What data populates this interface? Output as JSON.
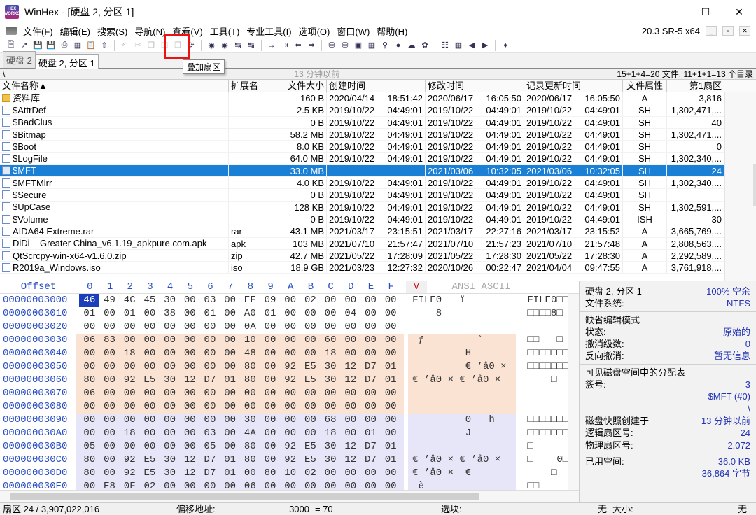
{
  "window": {
    "title": "WinHex - [硬盘 2, 分区 1]",
    "logo_top": "HEX",
    "logo_bottom": "WORKS"
  },
  "menu": {
    "items": [
      "文件(F)",
      "编辑(E)",
      "搜索(S)",
      "导航(N)",
      "查看(V)",
      "工具(T)",
      "专业工具(I)",
      "选项(O)",
      "窗口(W)",
      "帮助(H)"
    ],
    "version": "20.3 SR-5 x64"
  },
  "tooltip": "叠加扇区",
  "tabs": [
    "硬盘 2",
    "硬盘 2, 分区 1"
  ],
  "pathbar": {
    "root": "\\",
    "time": "13 分钟以前",
    "count": "15+1+4=20 文件, 11+1+1=13 个目录"
  },
  "columns": [
    "文件名称▲",
    "扩展名",
    "文件大小",
    "创建时间",
    "修改时间",
    "记录更新时间",
    "文件属性",
    "第1扇区"
  ],
  "files": [
    {
      "name": "资料库",
      "ext": "",
      "size": "160 B",
      "cd": "2020/04/14",
      "ct": "18:51:42",
      "md": "2020/06/17",
      "mt": "16:05:50",
      "rd": "2020/06/17",
      "rt": "16:05:50",
      "attr": "A",
      "sec": "3,816",
      "folder": true
    },
    {
      "name": "$AttrDef",
      "ext": "",
      "size": "2.5 KB",
      "cd": "2019/10/22",
      "ct": "04:49:01",
      "md": "2019/10/22",
      "mt": "04:49:01",
      "rd": "2019/10/22",
      "rt": "04:49:01",
      "attr": "SH",
      "sec": "1,302,471,..."
    },
    {
      "name": "$BadClus",
      "ext": "",
      "size": "0 B",
      "cd": "2019/10/22",
      "ct": "04:49:01",
      "md": "2019/10/22",
      "mt": "04:49:01",
      "rd": "2019/10/22",
      "rt": "04:49:01",
      "attr": "SH",
      "sec": "40"
    },
    {
      "name": "$Bitmap",
      "ext": "",
      "size": "58.2 MB",
      "cd": "2019/10/22",
      "ct": "04:49:01",
      "md": "2019/10/22",
      "mt": "04:49:01",
      "rd": "2019/10/22",
      "rt": "04:49:01",
      "attr": "SH",
      "sec": "1,302,471,..."
    },
    {
      "name": "$Boot",
      "ext": "",
      "size": "8.0 KB",
      "cd": "2019/10/22",
      "ct": "04:49:01",
      "md": "2019/10/22",
      "mt": "04:49:01",
      "rd": "2019/10/22",
      "rt": "04:49:01",
      "attr": "SH",
      "sec": "0"
    },
    {
      "name": "$LogFile",
      "ext": "",
      "size": "64.0 MB",
      "cd": "2019/10/22",
      "ct": "04:49:01",
      "md": "2019/10/22",
      "mt": "04:49:01",
      "rd": "2019/10/22",
      "rt": "04:49:01",
      "attr": "SH",
      "sec": "1,302,340,..."
    },
    {
      "name": "$MFT",
      "ext": "",
      "size": "33.0 MB",
      "cd": "",
      "ct": "",
      "md": "2021/03/06",
      "mt": "10:32:05",
      "rd": "2021/03/06",
      "rt": "10:32:05",
      "attr": "SH",
      "sec": "24",
      "selected": true
    },
    {
      "name": "$MFTMirr",
      "ext": "",
      "size": "4.0 KB",
      "cd": "2019/10/22",
      "ct": "04:49:01",
      "md": "2019/10/22",
      "mt": "04:49:01",
      "rd": "2019/10/22",
      "rt": "04:49:01",
      "attr": "SH",
      "sec": "1,302,340,..."
    },
    {
      "name": "$Secure",
      "ext": "",
      "size": "0 B",
      "cd": "2019/10/22",
      "ct": "04:49:01",
      "md": "2019/10/22",
      "mt": "04:49:01",
      "rd": "2019/10/22",
      "rt": "04:49:01",
      "attr": "SH",
      "sec": ""
    },
    {
      "name": "$UpCase",
      "ext": "",
      "size": "128 KB",
      "cd": "2019/10/22",
      "ct": "04:49:01",
      "md": "2019/10/22",
      "mt": "04:49:01",
      "rd": "2019/10/22",
      "rt": "04:49:01",
      "attr": "SH",
      "sec": "1,302,591,..."
    },
    {
      "name": "$Volume",
      "ext": "",
      "size": "0 B",
      "cd": "2019/10/22",
      "ct": "04:49:01",
      "md": "2019/10/22",
      "mt": "04:49:01",
      "rd": "2019/10/22",
      "rt": "04:49:01",
      "attr": "ISH",
      "sec": "30"
    },
    {
      "name": "AIDA64 Extreme.rar",
      "ext": "rar",
      "size": "43.1 MB",
      "cd": "2021/03/17",
      "ct": "23:15:51",
      "md": "2021/03/17",
      "mt": "22:27:16",
      "rd": "2021/03/17",
      "rt": "23:15:52",
      "attr": "A",
      "sec": "3,665,769,..."
    },
    {
      "name": "DiDi – Greater China_v6.1.19_apkpure.com.apk",
      "ext": "apk",
      "size": "103 MB",
      "cd": "2021/07/10",
      "ct": "21:57:47",
      "md": "2021/07/10",
      "mt": "21:57:23",
      "rd": "2021/07/10",
      "rt": "21:57:48",
      "attr": "A",
      "sec": "2,808,563,..."
    },
    {
      "name": "QtScrcpy-win-x64-v1.6.0.zip",
      "ext": "zip",
      "size": "42.7 MB",
      "cd": "2021/05/22",
      "ct": "17:28:09",
      "md": "2021/05/22",
      "mt": "17:28:30",
      "rd": "2021/05/22",
      "rt": "17:28:30",
      "attr": "A",
      "sec": "2,292,589,..."
    },
    {
      "name": "R2019a_Windows.iso",
      "ext": "iso",
      "size": "18.9 GB",
      "cd": "2021/03/23",
      "ct": "12:27:32",
      "md": "2020/10/26",
      "mt": "00:22:47",
      "rd": "2021/04/04",
      "rt": "09:47:55",
      "attr": "A",
      "sec": "3,761,918,..."
    }
  ],
  "hex": {
    "offset_header": "Offset",
    "col_headers": [
      "0",
      "1",
      "2",
      "3",
      "4",
      "5",
      "6",
      "7",
      "8",
      "9",
      "A",
      "B",
      "C",
      "D",
      "E",
      "F"
    ],
    "v_marker": "V",
    "ansi_header": "ANSI ASCII",
    "rows": [
      {
        "off": "00000003000",
        "bytes": "46 49 4C 45 30 00 03 00 EF 09 00 02 00 00 00 00",
        "ansi": "FILE0   ï",
        "ascii": "FILE0□□□",
        "tint": "none"
      },
      {
        "off": "00000003010",
        "bytes": "01 00 01 00 38 00 01 00 A0 01 00 00 00 04 00 00",
        "ansi": "    8",
        "ascii": "□□□□8□",
        "tint": "none"
      },
      {
        "off": "00000003020",
        "bytes": "00 00 00 00 00 00 00 00 0A 00 00 00 00 00 00 00",
        "ansi": "",
        "ascii": "",
        "tint": "none"
      },
      {
        "off": "00000003030",
        "bytes": "06 83 00 00 00 00 00 00 10 00 00 00 60 00 00 00",
        "ansi": " ƒ         `",
        "ascii": "□□   □",
        "tint": "tint"
      },
      {
        "off": "00000003040",
        "bytes": "00 00 18 00 00 00 00 00 48 00 00 00 18 00 00 00",
        "ansi": "         H",
        "ascii": "□□□□□□□□",
        "tint": "tint"
      },
      {
        "off": "00000003050",
        "bytes": "00 00 00 00 00 00 00 00 80 00 92 E5 30 12 D7 01",
        "ansi": "         € ’å0 ×",
        "ascii": "□□□□□□□□",
        "tint": "tint"
      },
      {
        "off": "00000003060",
        "bytes": "80 00 92 E5 30 12 D7 01 80 00 92 E5 30 12 D7 01",
        "ansi": "€ ’å0 × € ’å0 ×",
        "ascii": "    □",
        "tint": "tint"
      },
      {
        "off": "00000003070",
        "bytes": "06 00 00 00 00 00 00 00 00 00 00 00 00 00 00 00",
        "ansi": "",
        "ascii": "",
        "tint": "tint"
      },
      {
        "off": "00000003080",
        "bytes": "00 00 00 00 00 00 00 00 00 00 00 00 00 00 00 00",
        "ansi": "",
        "ascii": "",
        "tint": "tint"
      },
      {
        "off": "00000003090",
        "bytes": "00 00 00 00 00 00 00 00 30 00 00 00 68 00 00 00",
        "ansi": "         0   h",
        "ascii": "□□□□□□□□",
        "tint": "violet"
      },
      {
        "off": "000000030A0",
        "bytes": "00 00 18 00 00 00 03 00 4A 00 00 00 18 00 01 00",
        "ansi": "         J",
        "ascii": "□□□□□□□□",
        "tint": "violet"
      },
      {
        "off": "000000030B0",
        "bytes": "05 00 00 00 00 00 05 00 80 00 92 E5 30 12 D7 01",
        "ansi": "",
        "ascii": "□",
        "tint": "violet"
      },
      {
        "off": "000000030C0",
        "bytes": "80 00 92 E5 30 12 D7 01 80 00 92 E5 30 12 D7 01",
        "ansi": "€ ’å0 × € ’å0 ×",
        "ascii": "□    0□",
        "tint": "violet"
      },
      {
        "off": "000000030D0",
        "bytes": "80 00 92 E5 30 12 D7 01 00 80 10 02 00 00 00 00",
        "ansi": "€ ’å0 ×  €",
        "ascii": "    □",
        "tint": "violet"
      },
      {
        "off": "000000030E0",
        "bytes": "00 E8 0F 02 00 00 00 00 06 00 00 00 00 00 00 00",
        "ansi": " è",
        "ascii": "□□",
        "tint": "violet"
      }
    ]
  },
  "info": {
    "disk": "硬盘 2, 分区 1",
    "free": "100% 空余",
    "fs_label": "文件系统:",
    "fs": "NTFS",
    "mode_title": "缺省编辑模式",
    "state_label": "状态:",
    "state": "原始的",
    "undo_label": "撤消级数:",
    "undo": "0",
    "redo_label": "反向撤消:",
    "redo": "暂无信息",
    "alloc_title": "可见磁盘空间中的分配表",
    "cluster_label": "簇号:",
    "cluster": "3",
    "mft": "$MFT (#0)",
    "backslash": "\\",
    "snapshot_label": "磁盘快照创建于",
    "snapshot": "13 分钟以前",
    "logical_label": "逻辑扇区号:",
    "logical": "24",
    "physical_label": "物理扇区号:",
    "physical": "2,072",
    "used_label": "已用空间:",
    "used": "36.0 KB",
    "used_bytes": "36,864 字节"
  },
  "status": {
    "sector": "扇区 24 / 3,907,022,016",
    "offset_label": "偏移地址:",
    "offset": "3000",
    "eq": "= 70",
    "select_label": "选块:",
    "select": "无",
    "size_label": "大小:",
    "size": "无"
  }
}
